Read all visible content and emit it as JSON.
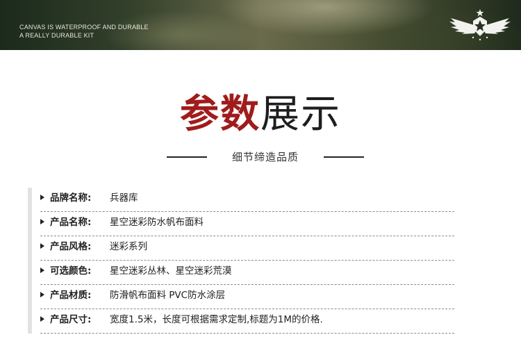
{
  "banner": {
    "line1": "CANVAS IS WATERPROOF AND DURABLE",
    "line2": "A REALLY DURABLE KIT",
    "logo_icon": "winged-star-emblem-icon"
  },
  "heading": {
    "accent": "参数",
    "rest": "展示",
    "subtitle": "细节缔造品质",
    "accent_color": "#a01c1c"
  },
  "specs": [
    {
      "label": "品牌名称:",
      "value": "兵器库"
    },
    {
      "label": "产品名称:",
      "value": "星空迷彩防水帆布面料"
    },
    {
      "label": "产品风格:",
      "value": "迷彩系列"
    },
    {
      "label": "可选颜色:",
      "value": "星空迷彩丛林、星空迷彩荒漠"
    },
    {
      "label": "产品材质:",
      "value": "防滑帆布面料  PVC防水涂层"
    },
    {
      "label": "产品尺寸:",
      "value": "宽度1.5米，长度可根据需求定制,标题为1M的价格."
    }
  ]
}
